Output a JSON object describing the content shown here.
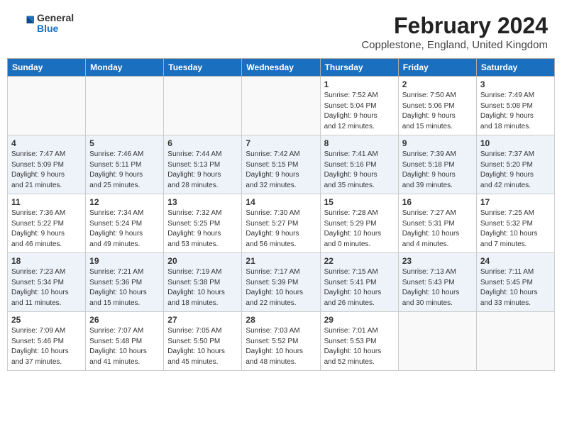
{
  "header": {
    "logo_general": "General",
    "logo_blue": "Blue",
    "month_year": "February 2024",
    "location": "Copplestone, England, United Kingdom"
  },
  "days_of_week": [
    "Sunday",
    "Monday",
    "Tuesday",
    "Wednesday",
    "Thursday",
    "Friday",
    "Saturday"
  ],
  "weeks": [
    [
      {
        "day": "",
        "info": ""
      },
      {
        "day": "",
        "info": ""
      },
      {
        "day": "",
        "info": ""
      },
      {
        "day": "",
        "info": ""
      },
      {
        "day": "1",
        "info": "Sunrise: 7:52 AM\nSunset: 5:04 PM\nDaylight: 9 hours\nand 12 minutes."
      },
      {
        "day": "2",
        "info": "Sunrise: 7:50 AM\nSunset: 5:06 PM\nDaylight: 9 hours\nand 15 minutes."
      },
      {
        "day": "3",
        "info": "Sunrise: 7:49 AM\nSunset: 5:08 PM\nDaylight: 9 hours\nand 18 minutes."
      }
    ],
    [
      {
        "day": "4",
        "info": "Sunrise: 7:47 AM\nSunset: 5:09 PM\nDaylight: 9 hours\nand 21 minutes."
      },
      {
        "day": "5",
        "info": "Sunrise: 7:46 AM\nSunset: 5:11 PM\nDaylight: 9 hours\nand 25 minutes."
      },
      {
        "day": "6",
        "info": "Sunrise: 7:44 AM\nSunset: 5:13 PM\nDaylight: 9 hours\nand 28 minutes."
      },
      {
        "day": "7",
        "info": "Sunrise: 7:42 AM\nSunset: 5:15 PM\nDaylight: 9 hours\nand 32 minutes."
      },
      {
        "day": "8",
        "info": "Sunrise: 7:41 AM\nSunset: 5:16 PM\nDaylight: 9 hours\nand 35 minutes."
      },
      {
        "day": "9",
        "info": "Sunrise: 7:39 AM\nSunset: 5:18 PM\nDaylight: 9 hours\nand 39 minutes."
      },
      {
        "day": "10",
        "info": "Sunrise: 7:37 AM\nSunset: 5:20 PM\nDaylight: 9 hours\nand 42 minutes."
      }
    ],
    [
      {
        "day": "11",
        "info": "Sunrise: 7:36 AM\nSunset: 5:22 PM\nDaylight: 9 hours\nand 46 minutes."
      },
      {
        "day": "12",
        "info": "Sunrise: 7:34 AM\nSunset: 5:24 PM\nDaylight: 9 hours\nand 49 minutes."
      },
      {
        "day": "13",
        "info": "Sunrise: 7:32 AM\nSunset: 5:25 PM\nDaylight: 9 hours\nand 53 minutes."
      },
      {
        "day": "14",
        "info": "Sunrise: 7:30 AM\nSunset: 5:27 PM\nDaylight: 9 hours\nand 56 minutes."
      },
      {
        "day": "15",
        "info": "Sunrise: 7:28 AM\nSunset: 5:29 PM\nDaylight: 10 hours\nand 0 minutes."
      },
      {
        "day": "16",
        "info": "Sunrise: 7:27 AM\nSunset: 5:31 PM\nDaylight: 10 hours\nand 4 minutes."
      },
      {
        "day": "17",
        "info": "Sunrise: 7:25 AM\nSunset: 5:32 PM\nDaylight: 10 hours\nand 7 minutes."
      }
    ],
    [
      {
        "day": "18",
        "info": "Sunrise: 7:23 AM\nSunset: 5:34 PM\nDaylight: 10 hours\nand 11 minutes."
      },
      {
        "day": "19",
        "info": "Sunrise: 7:21 AM\nSunset: 5:36 PM\nDaylight: 10 hours\nand 15 minutes."
      },
      {
        "day": "20",
        "info": "Sunrise: 7:19 AM\nSunset: 5:38 PM\nDaylight: 10 hours\nand 18 minutes."
      },
      {
        "day": "21",
        "info": "Sunrise: 7:17 AM\nSunset: 5:39 PM\nDaylight: 10 hours\nand 22 minutes."
      },
      {
        "day": "22",
        "info": "Sunrise: 7:15 AM\nSunset: 5:41 PM\nDaylight: 10 hours\nand 26 minutes."
      },
      {
        "day": "23",
        "info": "Sunrise: 7:13 AM\nSunset: 5:43 PM\nDaylight: 10 hours\nand 30 minutes."
      },
      {
        "day": "24",
        "info": "Sunrise: 7:11 AM\nSunset: 5:45 PM\nDaylight: 10 hours\nand 33 minutes."
      }
    ],
    [
      {
        "day": "25",
        "info": "Sunrise: 7:09 AM\nSunset: 5:46 PM\nDaylight: 10 hours\nand 37 minutes."
      },
      {
        "day": "26",
        "info": "Sunrise: 7:07 AM\nSunset: 5:48 PM\nDaylight: 10 hours\nand 41 minutes."
      },
      {
        "day": "27",
        "info": "Sunrise: 7:05 AM\nSunset: 5:50 PM\nDaylight: 10 hours\nand 45 minutes."
      },
      {
        "day": "28",
        "info": "Sunrise: 7:03 AM\nSunset: 5:52 PM\nDaylight: 10 hours\nand 48 minutes."
      },
      {
        "day": "29",
        "info": "Sunrise: 7:01 AM\nSunset: 5:53 PM\nDaylight: 10 hours\nand 52 minutes."
      },
      {
        "day": "",
        "info": ""
      },
      {
        "day": "",
        "info": ""
      }
    ]
  ]
}
